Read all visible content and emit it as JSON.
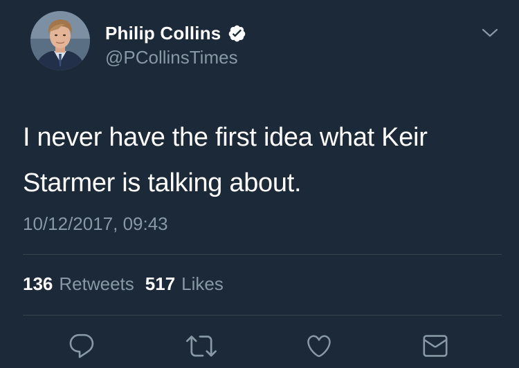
{
  "author": {
    "display_name": "Philip Collins",
    "handle": "@PCollinsTimes",
    "verified": true,
    "avatar_icon": "profile-photo"
  },
  "tweet": {
    "text_line1": "I never have the first idea what Keir",
    "text_line2": "Starmer is talking about.",
    "timestamp": "10/12/2017, 09:43"
  },
  "stats": {
    "retweets_count": "136",
    "retweets_label": "Retweets",
    "likes_count": "517",
    "likes_label": "Likes"
  },
  "actions": [
    {
      "icon": "reply-icon"
    },
    {
      "icon": "retweet-icon"
    },
    {
      "icon": "like-icon"
    },
    {
      "icon": "direct-message-icon"
    }
  ],
  "colors": {
    "background": "#1c2938",
    "primary_text": "#ffffff",
    "secondary_text": "#8899a6",
    "divider": "#38444d",
    "verified_badge": "#ffffff"
  }
}
